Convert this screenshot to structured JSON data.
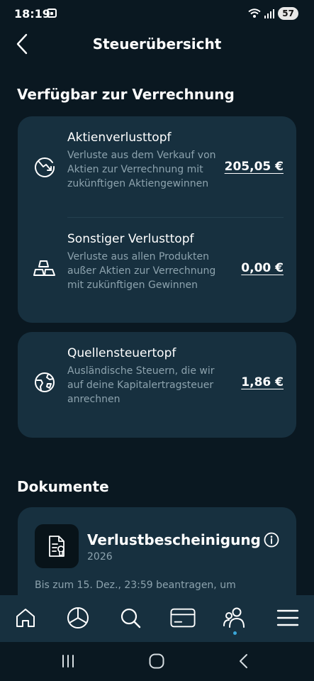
{
  "status_bar": {
    "time": "18:19",
    "battery": "57"
  },
  "header": {
    "title": "Steuerübersicht"
  },
  "offset_section": {
    "title": "Verfügbar zur Verrechnung",
    "items": [
      {
        "icon": "chart-down-icon",
        "title": "Aktienverlusttopf",
        "description": "Verluste aus dem Verkauf von Aktien zur Verrechnung mit zukünftigen Aktiengewinnen",
        "amount": "205,05 €"
      },
      {
        "icon": "gold-bars-icon",
        "title": "Sonstiger Verlusttopf",
        "description": "Verluste aus allen Produkten außer Aktien zur Verrechnung mit zukünftigen Gewinnen",
        "amount": "0,00 €"
      },
      {
        "icon": "globe-icon",
        "title": "Quellensteuertopf",
        "description": "Ausländische Steuern, die wir auf deine Kapitalertragsteuer anrechnen",
        "amount": "1,86 €"
      }
    ]
  },
  "documents_section": {
    "title": "Dokumente",
    "card": {
      "title": "Verlustbescheinigung",
      "year": "2026",
      "note": "Bis zum 15. Dez., 23:59 beantragen, um"
    }
  },
  "bottom_nav": {
    "items": [
      "home-icon",
      "portfolio-icon",
      "search-icon",
      "card-icon",
      "people-icon",
      "menu-icon"
    ],
    "active": "people-icon"
  },
  "colors": {
    "background": "#0a1821",
    "card": "#17303f",
    "muted_text": "#8da3ae",
    "accent_dot": "#3aa6d8"
  }
}
